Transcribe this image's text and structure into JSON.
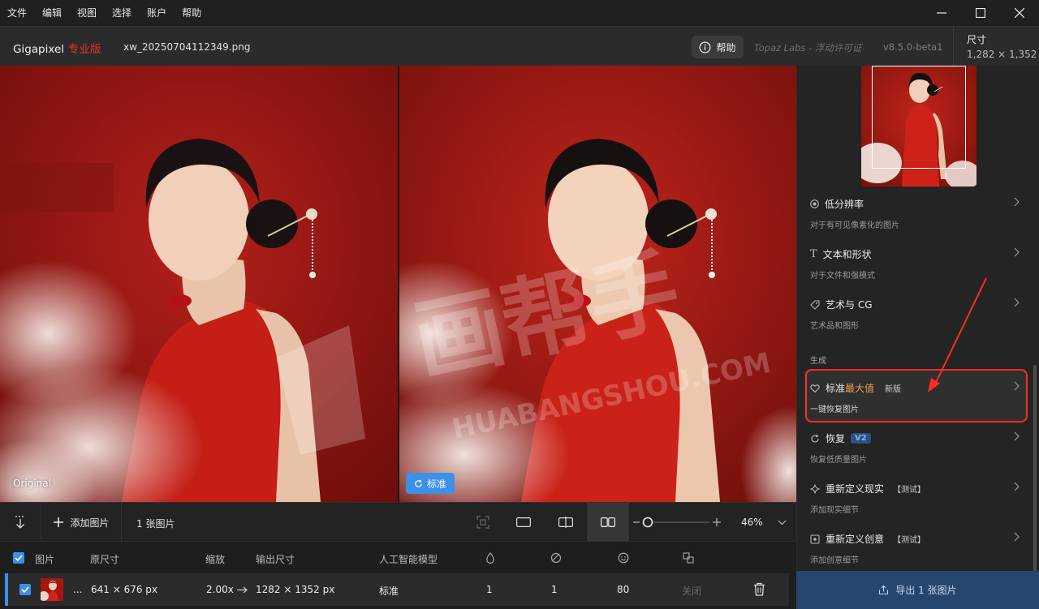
{
  "menubar": {
    "items": [
      "文件",
      "编辑",
      "视图",
      "选择",
      "账户",
      "帮助"
    ]
  },
  "header": {
    "app_name": "Gigapixel",
    "app_edition": "专业版",
    "file_name": "xw_20250704112349.png",
    "help_label": "帮助",
    "license_text": "Topaz Labs - 浮动许可证",
    "version": "v8.5.0-beta1",
    "size_title": "尺寸",
    "size_value": "1,282 × 1,352"
  },
  "preview": {
    "original_label": "Original",
    "standard_label": "标准",
    "watermark_text": "HUABANGSHOU.COM",
    "watermark_cn": "画帮手"
  },
  "toolbar": {
    "add_image_label": "添加图片",
    "image_count": "1 张图片",
    "zoom_value": "46%",
    "zoom_level": 0.05
  },
  "table": {
    "headers": {
      "image": "图片",
      "original_size": "原尺寸",
      "scale": "缩放",
      "output_size": "输出尺寸",
      "ai_model": "人工智能模型"
    },
    "rows": [
      {
        "ellipsis": "...",
        "original_size": "641 × 676 px",
        "scale": "2.00x",
        "output_size": "1282 × 1352 px",
        "model": "标准",
        "col1": "1",
        "col2": "1",
        "col3": "80",
        "col4": "关闭"
      }
    ]
  },
  "side": {
    "models": [
      {
        "title": "低分辨率",
        "desc": "对于有可见像素化的图片",
        "icon": "low-res-icon"
      },
      {
        "title": "文本和形状",
        "desc": "对于文件和强模式",
        "icon": "text-shape-icon"
      },
      {
        "title": "艺术与 CG",
        "desc": "艺术品和图形",
        "icon": "art-cg-icon"
      }
    ],
    "section_generate": "生成",
    "selected_model": {
      "title_main": "标准",
      "title_highlight": "最大值",
      "badge": "新版",
      "desc": "一键恢复图片"
    },
    "restore": {
      "title": "恢复",
      "badge": "V2",
      "desc": "恢复低质量图片"
    },
    "redefine_real": {
      "title": "重新定义现实",
      "badge": "【测试】",
      "desc": "添加现实细节"
    },
    "redefine_creative": {
      "title": "重新定义创意",
      "badge": "【测试】",
      "desc": "添加创意细节"
    },
    "export_label": "导出 1 张图片"
  },
  "colors": {
    "accent": "#3d8fe8",
    "edition_red": "#e5312f",
    "annotation_red": "#ff2b2b",
    "highlight_orange": "#f0a04b"
  }
}
